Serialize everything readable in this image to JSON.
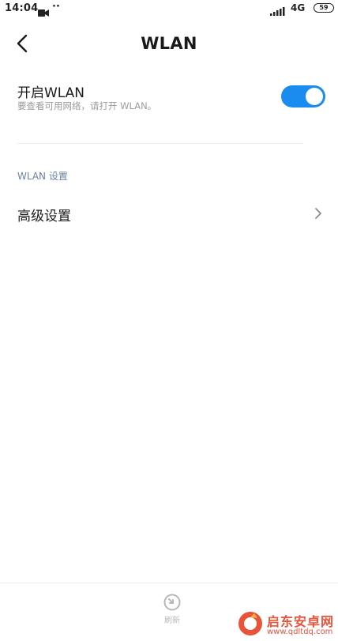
{
  "status_bar": {
    "time": "14:04",
    "dots": "··",
    "network": "4G",
    "battery": "59",
    "icons": [
      "video-icon",
      "signal-icon",
      "battery-icon"
    ]
  },
  "header": {
    "title": "WLAN",
    "back_icon": "chevron-left-icon"
  },
  "wlan_toggle": {
    "title": "开启WLAN",
    "subtitle": "要查看可用网络，请打开 WLAN。",
    "enabled": true
  },
  "section": {
    "header": "WLAN 设置"
  },
  "advanced": {
    "label": "高级设置",
    "icon": "chevron-right-icon"
  },
  "bottom": {
    "refresh_label": "刷新",
    "refresh_icon": "refresh-icon"
  },
  "watermark": {
    "text": "启东安卓网",
    "url": "www.qdltdq.com"
  },
  "colors": {
    "accent": "#1a8cf0",
    "section_header": "#6a82a6",
    "watermark": "#e8533a"
  }
}
